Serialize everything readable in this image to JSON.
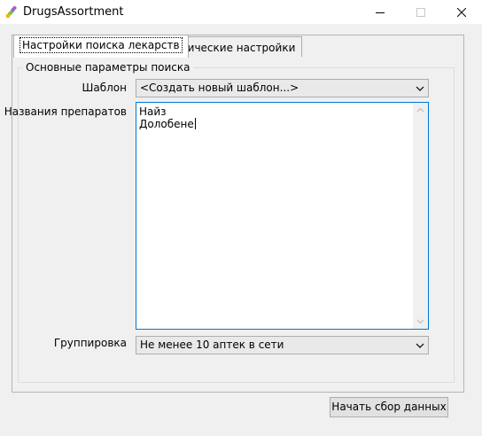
{
  "window": {
    "title": "DrugsAssortment"
  },
  "tabs": [
    {
      "label": "Настройки поиска лекарств",
      "active": true
    },
    {
      "label": "Технические настройки",
      "active": false
    }
  ],
  "group": {
    "title": "Основные параметры поиска"
  },
  "template": {
    "label": "Шаблон",
    "value": "<Создать новый шаблон...>"
  },
  "drugs": {
    "label": "Названия препаратов",
    "lines": [
      "Найз",
      "Долобене"
    ]
  },
  "grouping": {
    "label": "Группировка",
    "value": "Не менее 10 аптек в сети"
  },
  "start_button": {
    "label": "Начать сбор данных"
  },
  "colors": {
    "focus_border": "#0078d7",
    "background": "#f0f0f0"
  }
}
